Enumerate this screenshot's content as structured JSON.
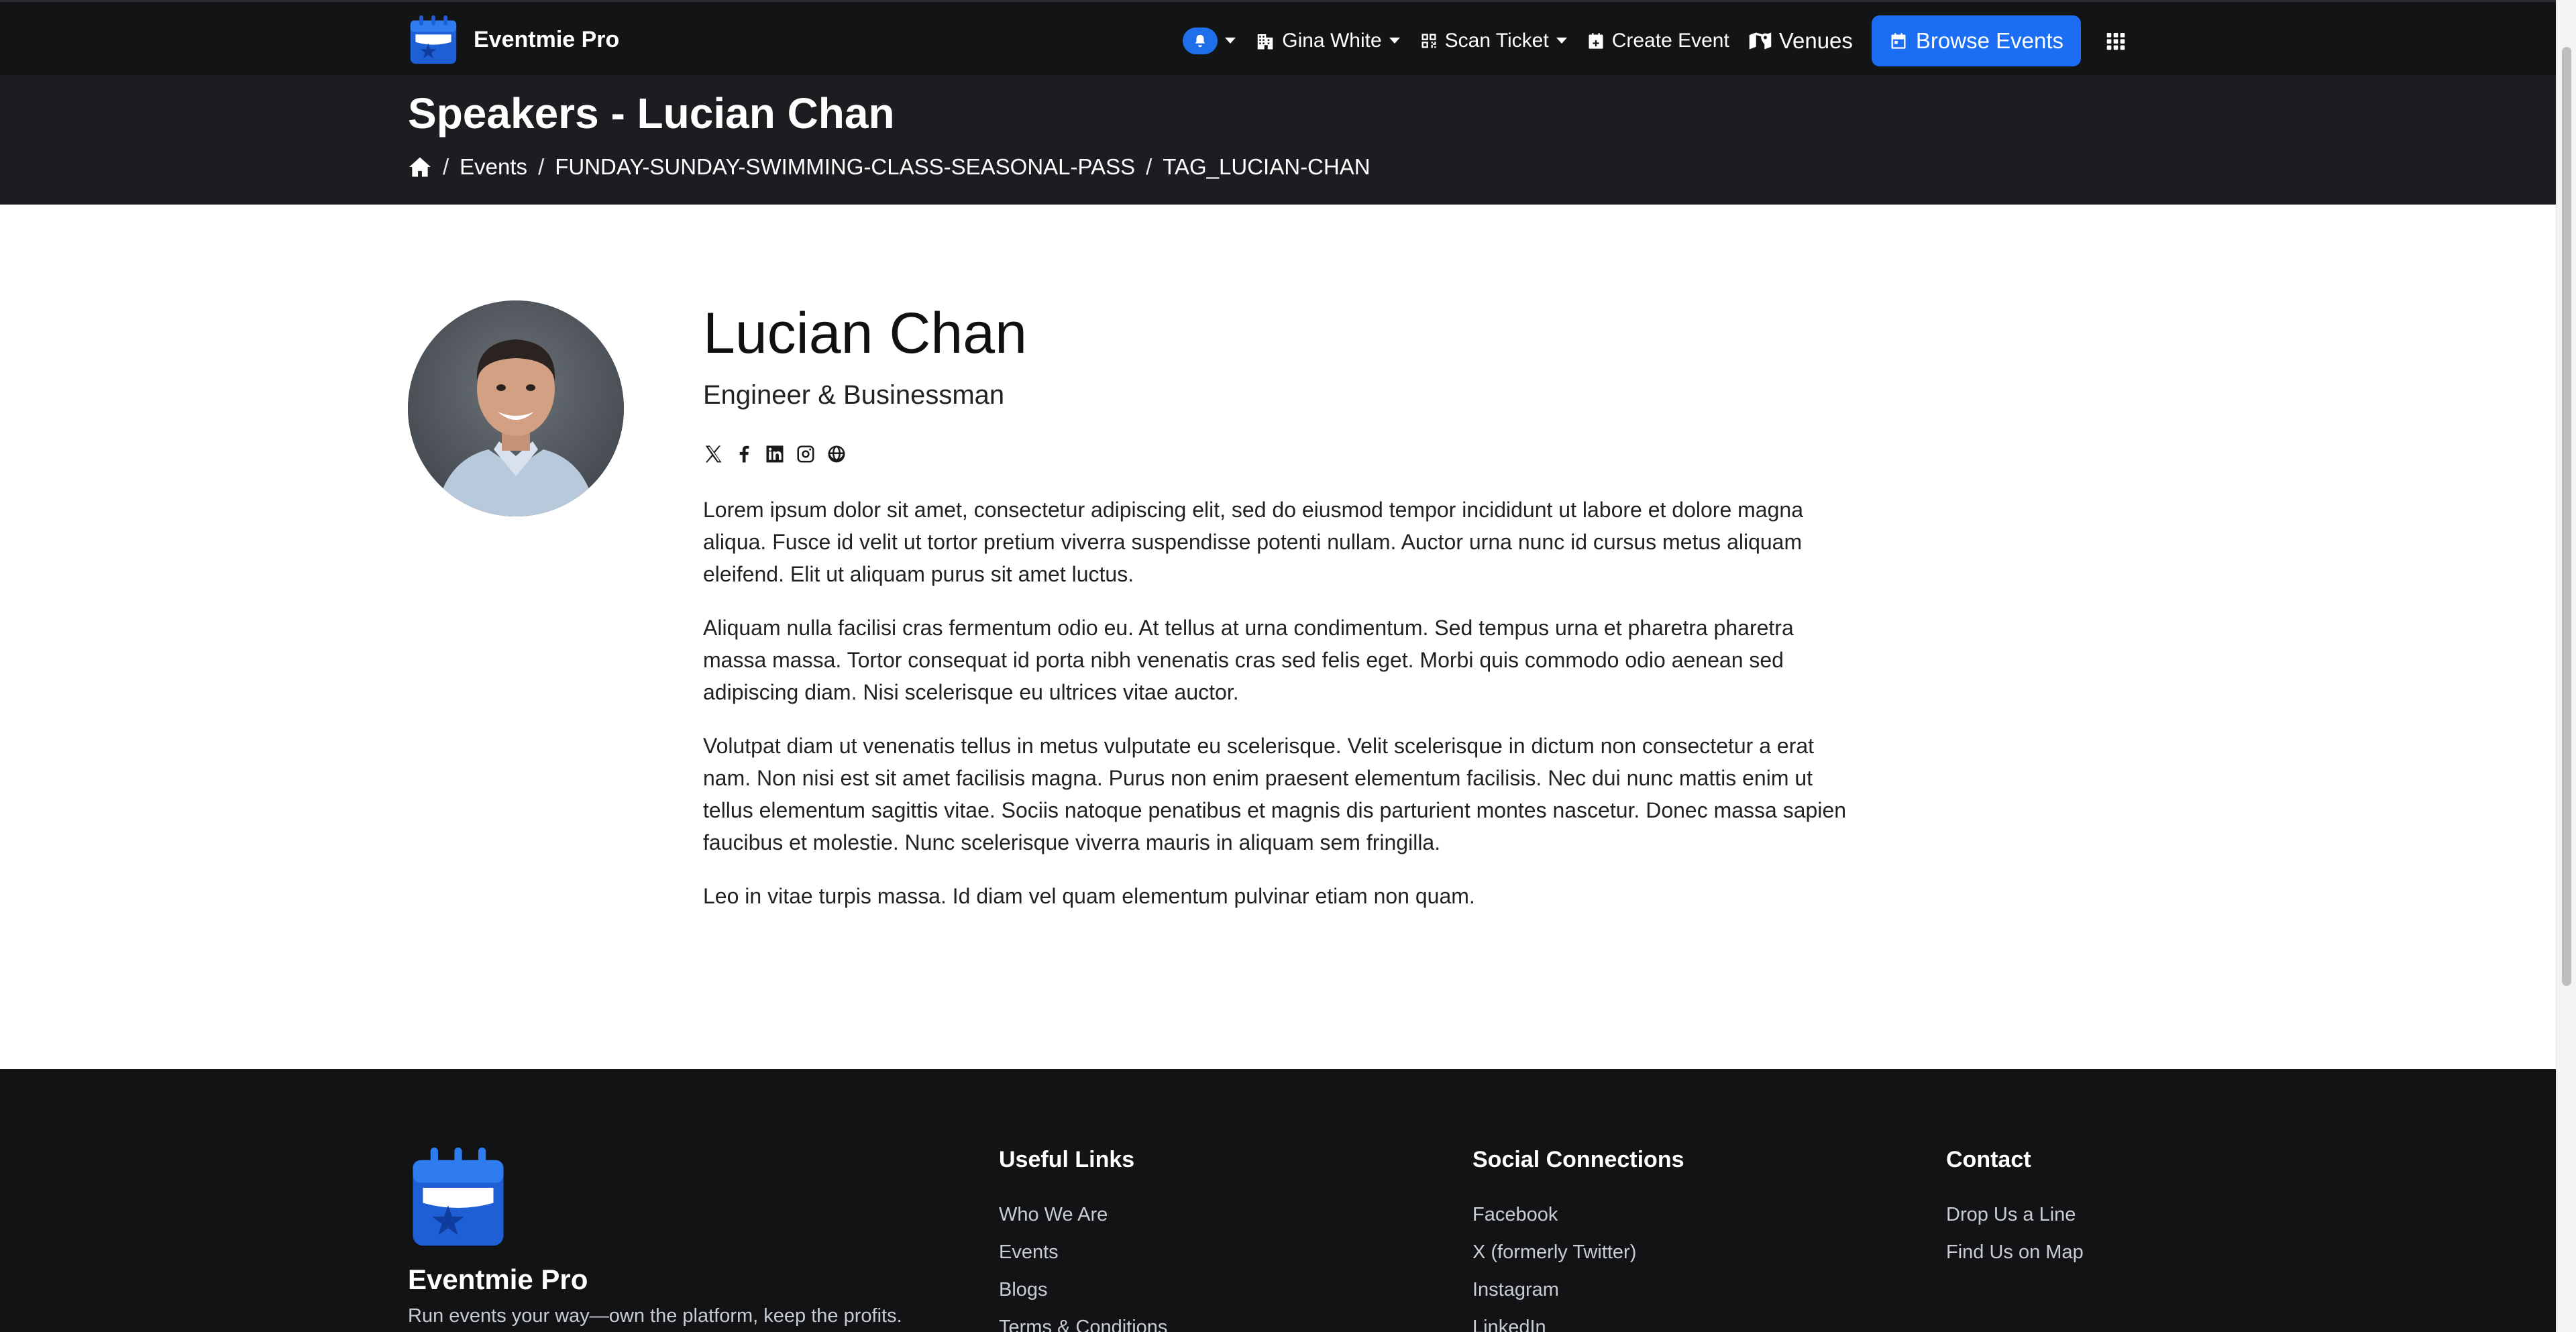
{
  "colors": {
    "navbar": "#131416",
    "title_band": "#1b1d21",
    "accent": "#1b6ef3",
    "footer": "#121315"
  },
  "navbar": {
    "brand_name": "Eventmie Pro",
    "user_name": "Gina White",
    "scan_ticket": "Scan Ticket",
    "create_event": "Create Event",
    "venues": "Venues",
    "browse_events": "Browse Events"
  },
  "page": {
    "title": "Speakers - Lucian Chan",
    "breadcrumb": [
      "Events",
      "FUNDAY-SUNDAY-SWIMMING-CLASS-SEASONAL-PASS",
      "TAG_LUCIAN-CHAN"
    ]
  },
  "speaker": {
    "name": "Lucian Chan",
    "role": "Engineer & Businessman",
    "socials": [
      "x-icon",
      "facebook-icon",
      "linkedin-icon",
      "instagram-icon",
      "globe-icon"
    ],
    "bio": [
      "Lorem ipsum dolor sit amet, consectetur adipiscing elit, sed do eiusmod tempor incididunt ut labore et dolore magna aliqua. Fusce id velit ut tortor pretium viverra suspendisse potenti nullam. Auctor urna nunc id cursus metus aliquam eleifend. Elit ut aliquam purus sit amet luctus.",
      "Aliquam nulla facilisi cras fermentum odio eu. At tellus at urna condimentum. Sed tempus urna et pharetra pharetra massa massa. Tortor consequat id porta nibh venenatis cras sed felis eget. Morbi quis commodo odio aenean sed adipiscing diam. Nisi scelerisque eu ultrices vitae auctor.",
      "Volutpat diam ut venenatis tellus in metus vulputate eu scelerisque. Velit scelerisque in dictum non consectetur a erat nam. Non nisi est sit amet facilisis magna. Purus non enim praesent elementum facilisis. Nec dui nunc mattis enim ut tellus elementum sagittis vitae. Sociis natoque penatibus et magnis dis parturient montes nascetur. Donec massa sapien faucibus et molestie. Nunc scelerisque viverra mauris in aliquam sem fringilla.",
      "Leo in vitae turpis massa. Id diam vel quam elementum pulvinar etiam non quam."
    ]
  },
  "footer": {
    "brand_name": "Eventmie Pro",
    "tagline": "Run events your way—own the platform, keep the profits.",
    "useful_links": {
      "heading": "Useful Links",
      "items": [
        "Who We Are",
        "Events",
        "Blogs",
        "Terms & Conditions"
      ]
    },
    "social": {
      "heading": "Social Connections",
      "items": [
        "Facebook",
        "X (formerly Twitter)",
        "Instagram",
        "LinkedIn"
      ]
    },
    "contact": {
      "heading": "Contact",
      "items": [
        "Drop Us a Line",
        "Find Us on Map"
      ]
    }
  }
}
